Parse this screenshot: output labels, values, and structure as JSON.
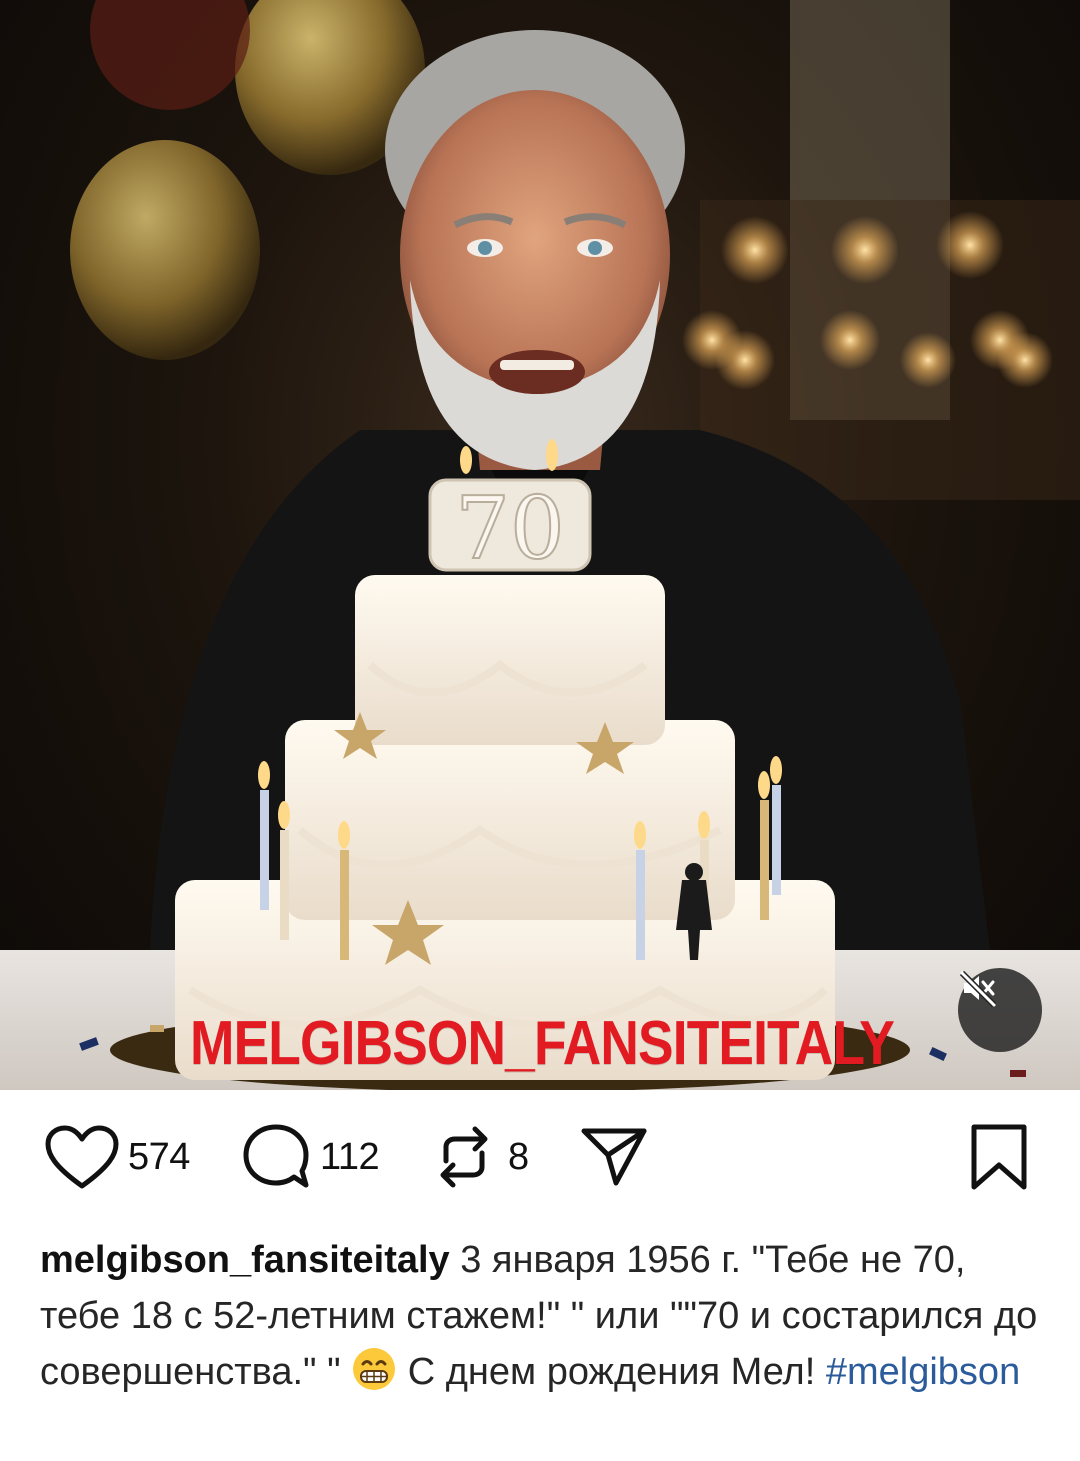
{
  "post": {
    "watermark": "MELGIBSON_FANSITEITALY",
    "candle_number": "70"
  },
  "actions": {
    "likes": "574",
    "comments": "112",
    "reposts": "8"
  },
  "caption": {
    "username": "melgibson_fansiteitaly",
    "text_before_emoji": "3 января 1956 г. \"Тебе не 70, тебе 18 с 52-летним стажем!\" \" или \"\"70 и состарился до совершенства.\" \"",
    "text_after_emoji": " С днем рождения Мел! ",
    "emoji": "grinning-face",
    "hashtag": "#melgibson"
  },
  "icons": {
    "like": "heart-icon",
    "comment": "comment-bubble-icon",
    "repost": "repost-icon",
    "share": "paper-plane-icon",
    "save": "bookmark-icon",
    "mute": "speaker-muted-icon"
  },
  "colors": {
    "watermark": "#e21b23",
    "hashtag": "#2b5b9b"
  }
}
